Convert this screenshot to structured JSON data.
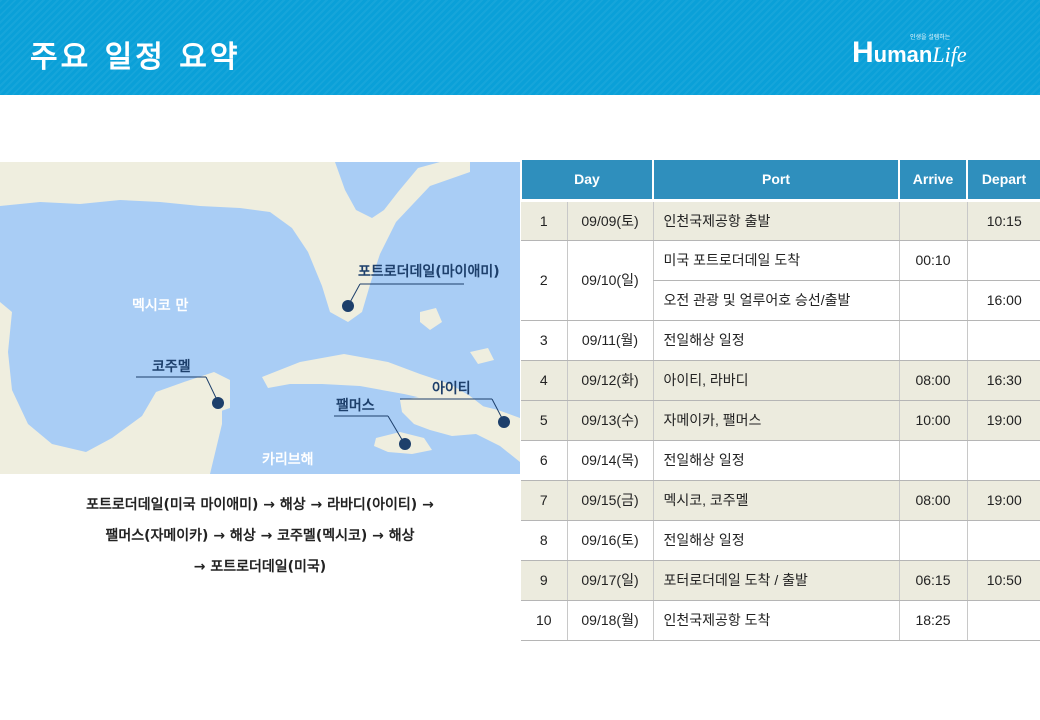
{
  "header": {
    "title": "주요 일정 요약",
    "logo_text_h": "H",
    "logo_text_uman": "uman",
    "logo_text_life": "Life",
    "logo_tagline": "인생을 설렘하는"
  },
  "map": {
    "labels": {
      "gulf": "멕시코 만",
      "caribbean": "카리브해",
      "fort": "포트로더데일(마이애미)",
      "cozumel": "코주멜",
      "falmouth": "팰머스",
      "haiti": "아이티"
    },
    "colors": {
      "sea": "#a9cdf5",
      "land": "#efeedf",
      "marker": "#1d3f6b"
    }
  },
  "route": {
    "line1": "포트로더데일(미국 마이애미) → 해상 → 라바디(아이티) →",
    "line2": "팰머스(자메이카) → 해상 → 코주멜(멕시코) → 해상",
    "line3": "→ 포트로더데일(미국)"
  },
  "table": {
    "headers": {
      "day": "Day",
      "port": "Port",
      "arrive": "Arrive",
      "depart": "Depart"
    },
    "rows": [
      {
        "no": "1",
        "date": "09/09(토)",
        "port": "인천국제공항 출발",
        "arrive": "",
        "depart": "10:15"
      },
      {
        "no": "2",
        "date": "09/10(일)",
        "port": "미국 포트로더데일 도착",
        "arrive": "00:10",
        "depart": ""
      },
      {
        "port": "오전 관광 및 얼루어호 승선/출발",
        "arrive": "",
        "depart": "16:00"
      },
      {
        "no": "3",
        "date": "09/11(월)",
        "port": "전일해상 일정",
        "arrive": "",
        "depart": ""
      },
      {
        "no": "4",
        "date": "09/12(화)",
        "port": "아이티, 라바디",
        "arrive": "08:00",
        "depart": "16:30"
      },
      {
        "no": "5",
        "date": "09/13(수)",
        "port": "자메이카, 팰머스",
        "arrive": "10:00",
        "depart": "19:00"
      },
      {
        "no": "6",
        "date": "09/14(목)",
        "port": "전일해상 일정",
        "arrive": "",
        "depart": ""
      },
      {
        "no": "7",
        "date": "09/15(금)",
        "port": "멕시코, 코주멜",
        "arrive": "08:00",
        "depart": "19:00"
      },
      {
        "no": "8",
        "date": "09/16(토)",
        "port": "전일해상 일정",
        "arrive": "",
        "depart": ""
      },
      {
        "no": "9",
        "date": "09/17(일)",
        "port": "포터로더데일 도착 / 출발",
        "arrive": "06:15",
        "depart": "10:50"
      },
      {
        "no": "10",
        "date": "09/18(월)",
        "port": "인천국제공항 도착",
        "arrive": "18:25",
        "depart": ""
      }
    ]
  }
}
